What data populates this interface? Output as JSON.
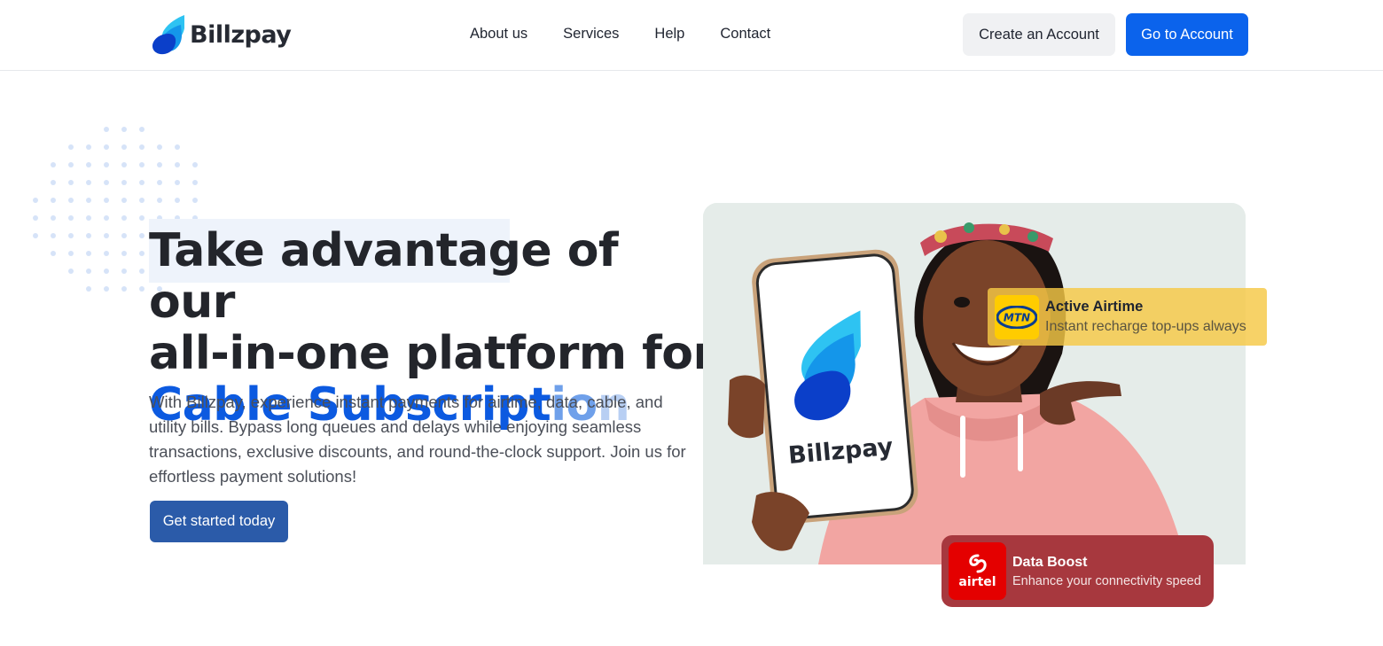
{
  "header": {
    "brand": "Billzpay",
    "nav": [
      "About us",
      "Services",
      "Help",
      "Contact"
    ],
    "create_account_label": "Create an Account",
    "go_to_account_label": "Go to Account"
  },
  "hero": {
    "headline_line1": "Take advantage of our",
    "headline_line2": "all-in-one platform for",
    "headline_highlight": "Cable Subscript",
    "headline_fade1": "io",
    "headline_fade2": "n",
    "description": "With Billzpay, experience instant payments for airtime, data, cable, and utility bills. Bypass long queues and delays while enjoying seamless transactions, exclusive discounts, and round-the-clock support. Join us for effortless payment solutions!",
    "cta_label": "Get started today",
    "phone_brand": "Billzpay"
  },
  "cards": {
    "mtn": {
      "logo_text": "MTN",
      "title": "Active Airtime",
      "subtitle": "Instant recharge top-ups always"
    },
    "airtel": {
      "logo_text": "airtel",
      "title": "Data Boost",
      "subtitle": "Enhance your connectivity speed"
    }
  },
  "colors": {
    "primary": "#0b63ec",
    "cta": "#2b5ba9",
    "headline_blue": "#0c5ae0",
    "mtn_yellow": "#ffcc00",
    "airtel_red": "#e40000"
  }
}
